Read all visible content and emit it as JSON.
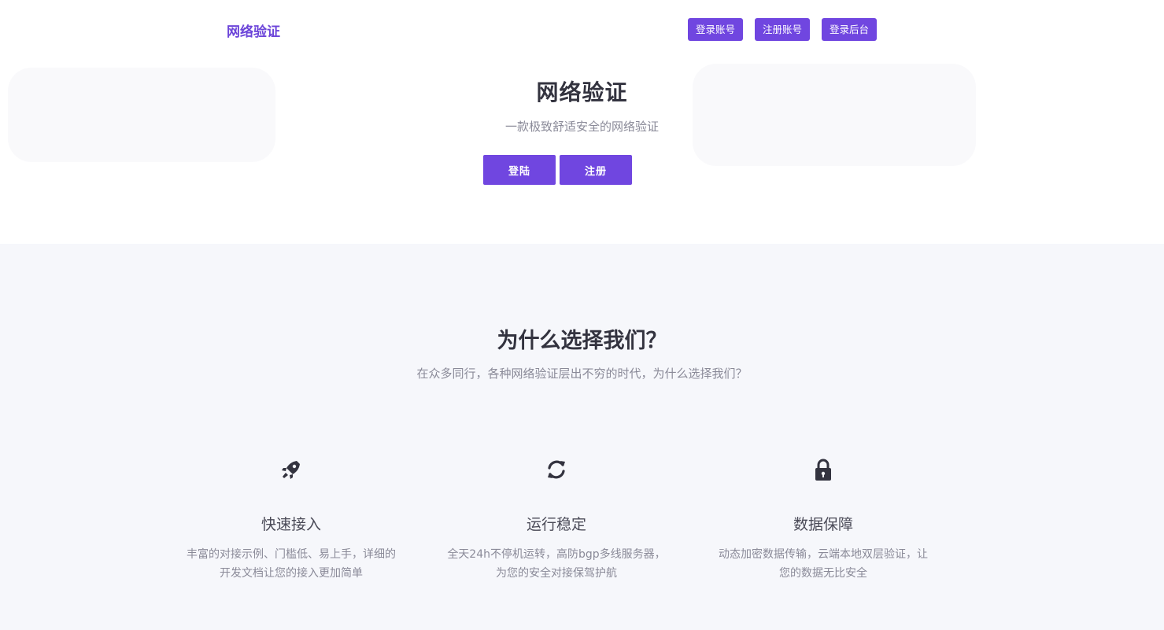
{
  "navbar": {
    "brand": "网络验证",
    "buttons": {
      "login": "登录账号",
      "register": "注册账号",
      "admin": "登录后台"
    }
  },
  "hero": {
    "title": "网络验证",
    "subtitle": "一款极致舒适安全的网络验证",
    "login_label": "登陆",
    "register_label": "注册"
  },
  "features": {
    "title": "为什么选择我们？",
    "subtitle": "在众多同行，各种网络验证层出不穷的时代，为什么选择我们？",
    "items": [
      {
        "icon": "rocket-icon",
        "title": "快速接入",
        "desc_line1": "丰富的对接示例、门槛低、易上手，详细的",
        "desc_line2": "开发文档让您的接入更加简单"
      },
      {
        "icon": "refresh-icon",
        "title": "运行稳定",
        "desc_line1": "全天24h不停机运转，高防bgp多线服务器，",
        "desc_line2": "为您的安全对接保驾护航"
      },
      {
        "icon": "lock-icon",
        "title": "数据保障",
        "desc_line1": "动态加密数据传输，云端本地双层验证，让",
        "desc_line2": "您的数据无比安全"
      }
    ]
  },
  "colors": {
    "accent": "#7046e0",
    "brand_text": "#6c45d9",
    "features_bg": "#f6f7fb",
    "icon": "#33333f"
  }
}
